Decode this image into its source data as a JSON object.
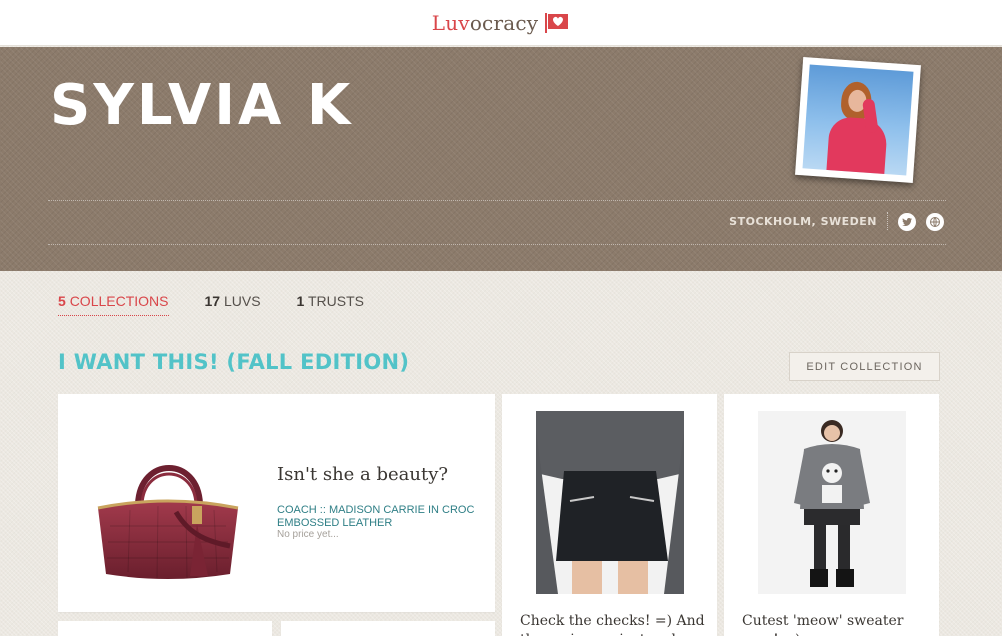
{
  "brand": {
    "luv": "Luv",
    "ocracy": "ocracy"
  },
  "profile": {
    "name": "SYLVIA K",
    "location": "STOCKHOLM, SWEDEN"
  },
  "stats": [
    {
      "count": "5",
      "label": "COLLECTIONS"
    },
    {
      "count": "17",
      "label": "LUVS"
    },
    {
      "count": "1",
      "label": "TRUSTS"
    }
  ],
  "collection": {
    "title": "I WANT THIS! (FALL EDITION)",
    "edit_label": "EDIT COLLECTION"
  },
  "items": [
    {
      "caption": "Isn't she a beauty?",
      "product": "COACH :: MADISON CARRIE IN CROC EMBOSSED LEATHER",
      "price": "No price yet..."
    },
    {
      "caption": "Check the checks! =) And these zippers just make"
    },
    {
      "caption": "Cutest 'meow' sweater ever! =)"
    }
  ],
  "colors": {
    "accent_red": "#d9464a",
    "accent_teal": "#52c3c8",
    "header_brown": "#8c7b6b"
  },
  "icons": [
    "twitter-icon",
    "globe-icon"
  ]
}
